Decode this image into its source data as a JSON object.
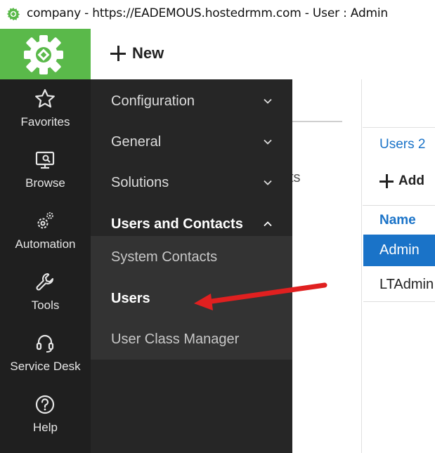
{
  "window": {
    "title": "company - https://EADEMOUS.hostedrmm.com - User : Admin",
    "app_icon": "gear-icon"
  },
  "header": {
    "logo_icon": "gear-logo-icon",
    "new_label": "New",
    "brand_color": "#5ab94a"
  },
  "sidebar": {
    "items": [
      {
        "label": "Favorites",
        "icon": "star-icon"
      },
      {
        "label": "Browse",
        "icon": "monitor-search-icon"
      },
      {
        "label": "Automation",
        "icon": "gears-icon"
      },
      {
        "label": "Tools",
        "icon": "wrench-icon"
      },
      {
        "label": "Service Desk",
        "icon": "headset-icon"
      },
      {
        "label": "Help",
        "icon": "help-icon"
      }
    ]
  },
  "flyout": {
    "sections": [
      {
        "label": "Configuration",
        "expanded": false
      },
      {
        "label": "General",
        "expanded": false
      },
      {
        "label": "Solutions",
        "expanded": false
      },
      {
        "label": "Users and Contacts",
        "expanded": true
      }
    ],
    "submenu": [
      {
        "label": "System Contacts"
      },
      {
        "label": "Users"
      },
      {
        "label": "User Class Manager"
      }
    ]
  },
  "content": {
    "partial_text": "ts",
    "users_tab_label": "Users 2",
    "add_label": "Add",
    "column_name": "Name",
    "rows": [
      {
        "name": "Admin",
        "selected": true
      },
      {
        "name": "LTAdmin",
        "selected": false
      }
    ],
    "accent_color": "#1a73c8"
  },
  "annotation": {
    "arrow_color": "#e02020",
    "points_to": "Users"
  }
}
